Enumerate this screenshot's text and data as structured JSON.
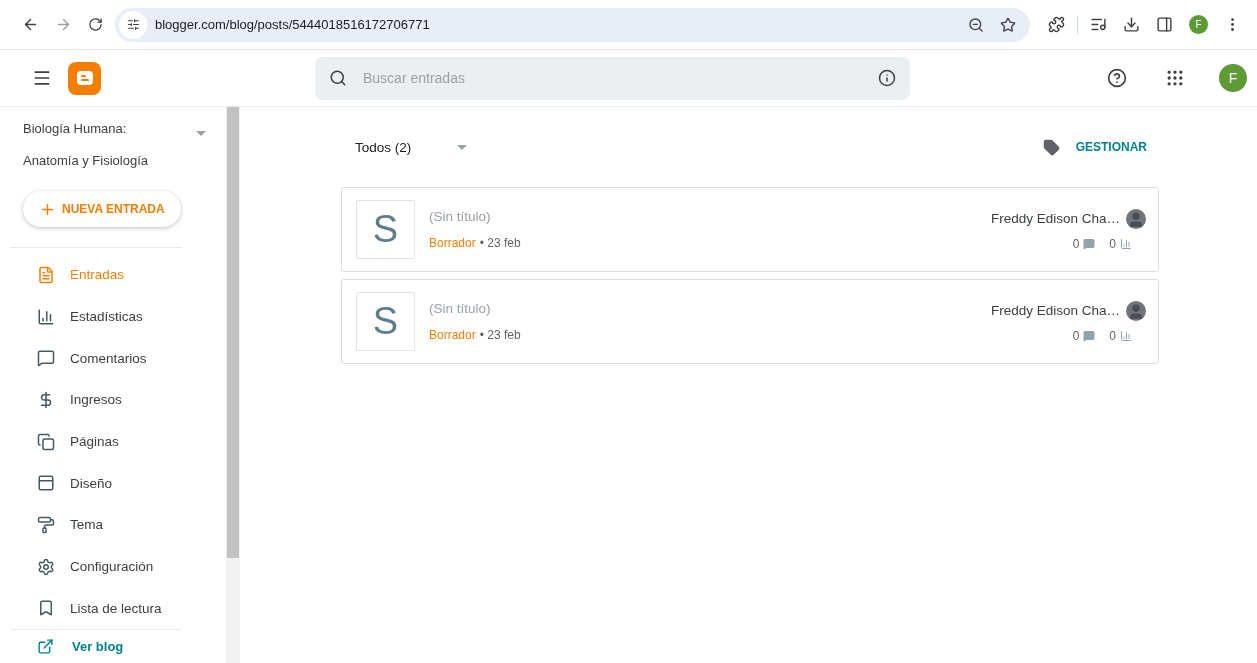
{
  "browser": {
    "url": "blogger.com/blog/posts/5444018516172706771",
    "profile_initial": "F"
  },
  "header": {
    "search": {
      "placeholder": "Buscar entradas"
    },
    "avatar_initial": "F"
  },
  "sidebar": {
    "blog_title": "Biología Humana: Anatomía y Fisiología",
    "new_post": "NUEVA ENTRADA",
    "items": [
      {
        "label": "Entradas",
        "selected": true
      },
      {
        "label": "Estadísticas",
        "selected": false
      },
      {
        "label": "Comentarios",
        "selected": false
      },
      {
        "label": "Ingresos",
        "selected": false
      },
      {
        "label": "Páginas",
        "selected": false
      },
      {
        "label": "Diseño",
        "selected": false
      },
      {
        "label": "Tema",
        "selected": false
      },
      {
        "label": "Configuración",
        "selected": false
      },
      {
        "label": "Lista de lectura",
        "selected": false
      }
    ],
    "view_blog": "Ver blog"
  },
  "toolbar": {
    "filter": "Todos (2)",
    "manage": "GESTIONAR"
  },
  "posts": [
    {
      "thumb": "S",
      "title": "(Sin título)",
      "status": "Borrador",
      "date": "• 23 feb",
      "author": "Freddy Edison Cha…",
      "comments": "0",
      "views": "0"
    },
    {
      "thumb": "S",
      "title": "(Sin título)",
      "status": "Borrador",
      "date": "• 23 feb",
      "author": "Freddy Edison Cha…",
      "comments": "0",
      "views": "0"
    }
  ]
}
